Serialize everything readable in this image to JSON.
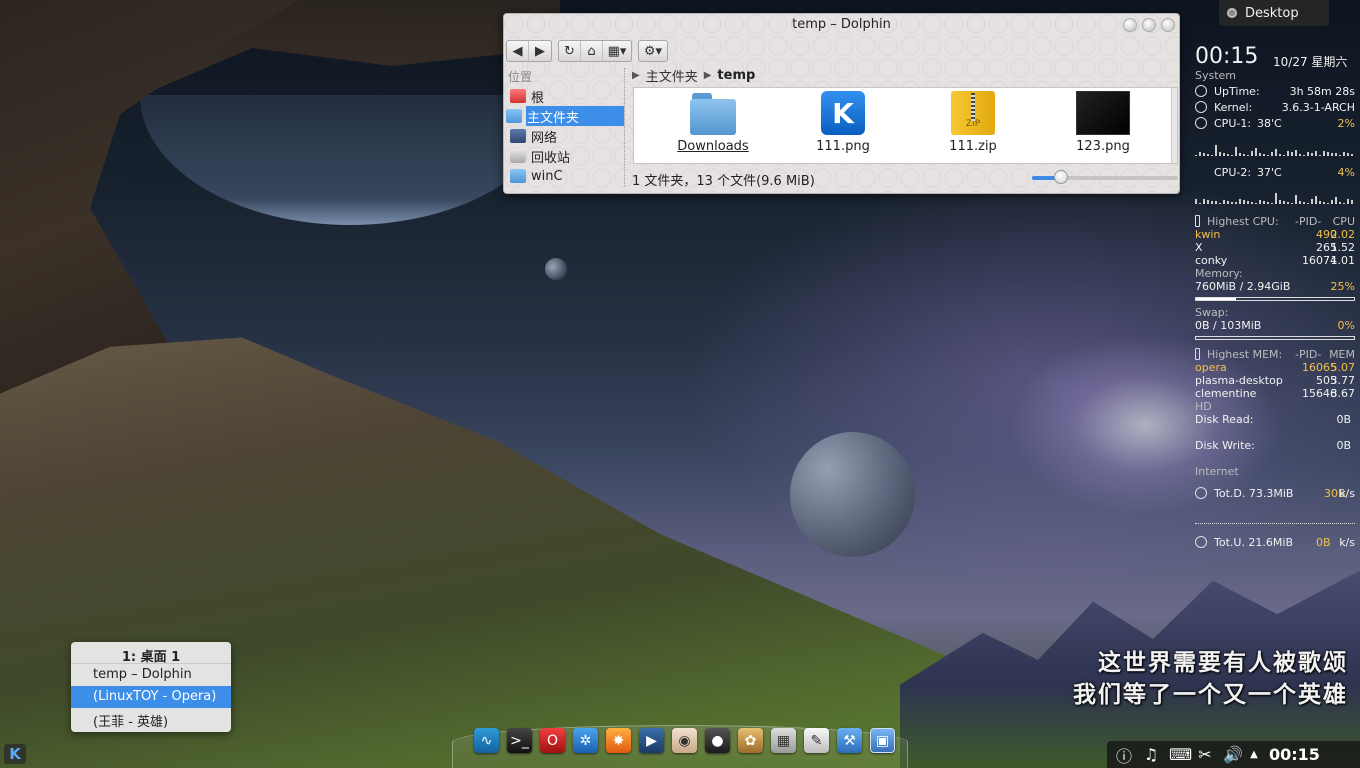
{
  "desktop_button": {
    "label": "Desktop"
  },
  "wallpaper_lyrics": {
    "line1": "这世界需要有人被歌颂",
    "line2": "我们等了一个又一个英雄"
  },
  "dolphin": {
    "title": "temp – Dolphin",
    "toolbar_icons": [
      "back-icon",
      "forward-icon",
      "reload-icon",
      "home-icon",
      "view-mode-icon",
      "settings-icon"
    ],
    "places_header": "位置",
    "places": [
      {
        "label": "根",
        "icon": "root-folder-icon",
        "color": "#e04444"
      },
      {
        "label": "主文件夹",
        "icon": "home-folder-icon",
        "selected": true
      },
      {
        "label": "网络",
        "icon": "network-icon"
      },
      {
        "label": "回收站",
        "icon": "trash-icon"
      },
      {
        "label": "winC",
        "icon": "drive-folder-icon"
      }
    ],
    "breadcrumb": {
      "parent": "主文件夹",
      "current": "temp"
    },
    "files": [
      {
        "name": "Downloads",
        "icon": "folder-icon"
      },
      {
        "name": "111.png",
        "icon": "kde-image-icon"
      },
      {
        "name": "111.zip",
        "icon": "zip-archive-icon",
        "badge": "ZIP"
      },
      {
        "name": "123.png",
        "icon": "image-thumbnail-icon"
      }
    ],
    "status": "1 文件夹，13 个文件(9.6 MiB)",
    "zoom_level": 0.2
  },
  "conky": {
    "time": "00:15",
    "date": "10/27 星期六",
    "system_header": "System",
    "uptime_label": "UpTime:",
    "uptime_value": "3h 58m 28s",
    "kernel_label": "Kernel:",
    "kernel_value": "3.6.3-1-ARCH",
    "cpu1_label": "CPU-1:",
    "cpu1_temp": "38'C",
    "cpu1_pct": "2%",
    "cpu2_label": "CPU-2:",
    "cpu2_temp": "37'C",
    "cpu2_pct": "4%",
    "top_cpu": {
      "title": "Highest CPU:",
      "col_pid": "-PID-",
      "col_val": "CPU",
      "rows": [
        {
          "name": "kwin",
          "pid": "490",
          "val": "2.02"
        },
        {
          "name": "X",
          "pid": "265",
          "val": "1.52"
        },
        {
          "name": "conky",
          "pid": "16074",
          "val": "1.01"
        }
      ]
    },
    "memory_label": "Memory:",
    "memory_value": "760MiB / 2.94GiB",
    "memory_pct": "25%",
    "memory_fill": 0.25,
    "swap_label": "Swap:",
    "swap_value": "0B   / 103MiB",
    "swap_pct": "0%",
    "swap_fill": 0,
    "top_mem": {
      "title": "Highest MEM:",
      "col_pid": "-PID-",
      "col_val": "MEM",
      "rows": [
        {
          "name": "opera",
          "pid": "16065",
          "val": "5.07"
        },
        {
          "name": "plasma-desktop",
          "pid": "505",
          "val": "3.77"
        },
        {
          "name": "clementine",
          "pid": "15646",
          "val": "3.67"
        }
      ]
    },
    "hd_header": "HD",
    "disk_read_label": "Disk Read:",
    "disk_read_value": "0B",
    "disk_write_label": "Disk Write:",
    "disk_write_value": "0B",
    "internet_header": "Internet",
    "down_label": "Tot.D. 73.3MiB",
    "down_rate": "30B",
    "down_unit": "k/s",
    "up_label": "Tot.U. 21.6MiB",
    "up_rate": "0B",
    "up_unit": "k/s",
    "accent_color": "#f2c04a"
  },
  "switcher": {
    "title": "1: 桌面 1",
    "items": [
      {
        "label": "temp – Dolphin"
      },
      {
        "label": "(LinuxTOY - Opera)",
        "selected": true
      },
      {
        "label": "(王菲 - 英雄)"
      }
    ]
  },
  "dock": {
    "icons": [
      "system-monitor-icon",
      "terminal-icon",
      "opera-icon",
      "kde-settings-icon",
      "image-viewer-icon",
      "video-editor-icon",
      "eye-icon",
      "camera-icon",
      "paint-icon",
      "calculator-icon",
      "text-editor-icon",
      "tools-icon",
      "window-manager-icon"
    ]
  },
  "tray": {
    "icons": [
      "info-icon",
      "music-note-icon",
      "keyboard-icon",
      "scissors-icon",
      "volume-icon",
      "arrow-up-icon"
    ],
    "clock": "00:15"
  }
}
